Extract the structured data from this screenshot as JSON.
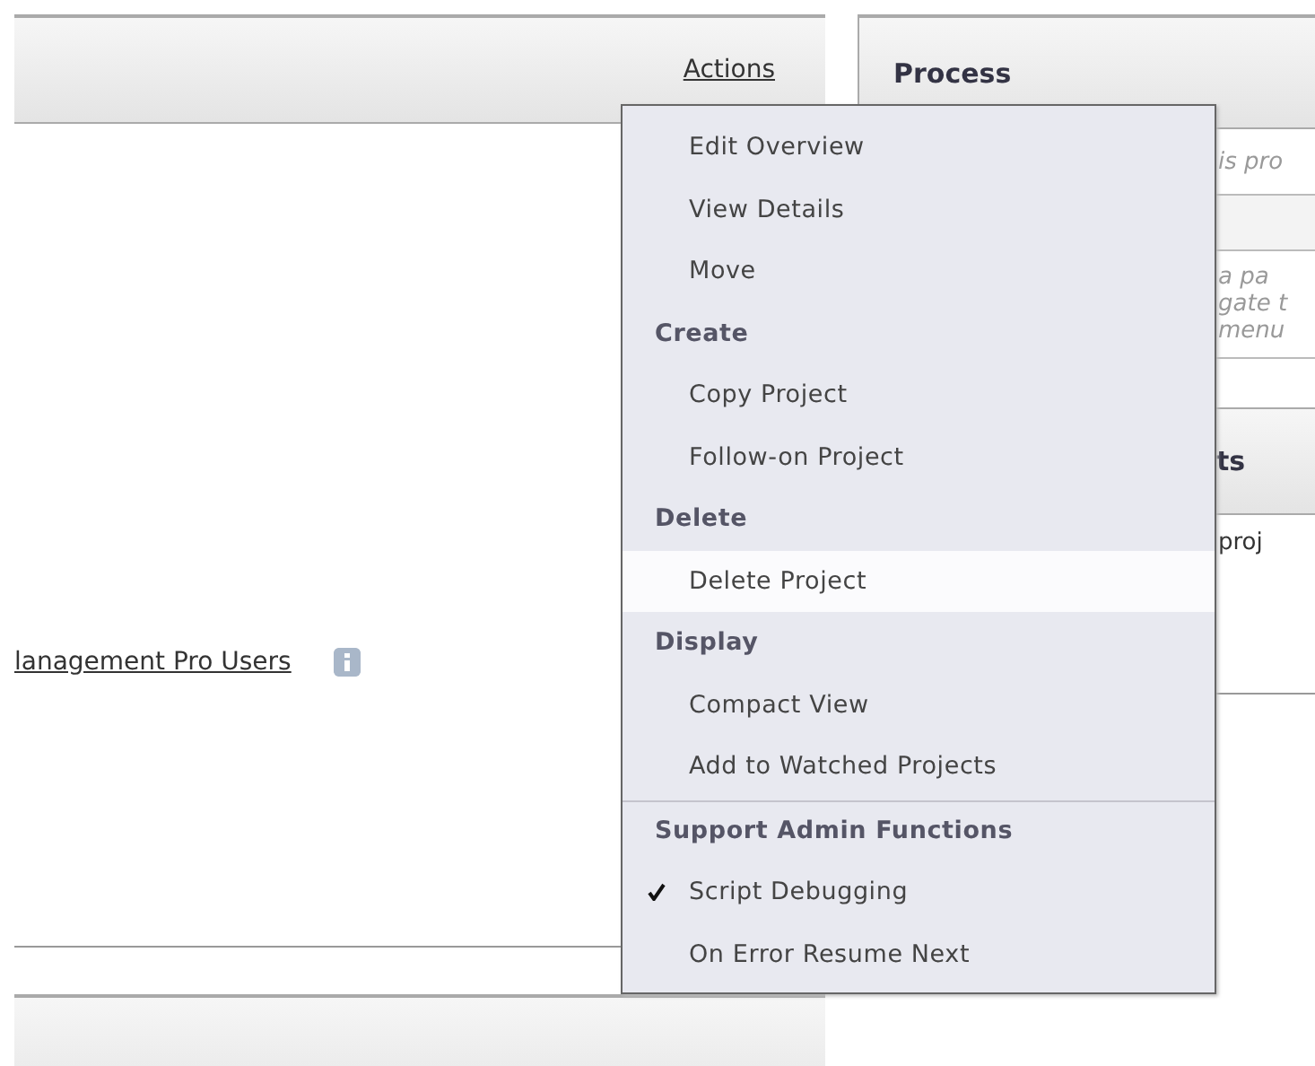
{
  "left_panel": {
    "actions_link": "Actions",
    "group_link": "lanagement Pro Users"
  },
  "right_panel": {
    "title": "Process",
    "hint_1": "is pro",
    "hint_2": [
      "a pa",
      "gate t",
      "menu"
    ],
    "section_title": "ts",
    "section_text": "proj"
  },
  "actions_menu": [
    {
      "kind": "item",
      "label": "Edit Overview",
      "selected": false,
      "checked": false
    },
    {
      "kind": "item",
      "label": "View Details",
      "selected": false,
      "checked": false
    },
    {
      "kind": "item",
      "label": "Move",
      "selected": false,
      "checked": false
    },
    {
      "kind": "header",
      "label": "Create",
      "divider_above": false
    },
    {
      "kind": "item",
      "label": "Copy Project",
      "selected": false,
      "checked": false
    },
    {
      "kind": "item",
      "label": "Follow-on Project",
      "selected": false,
      "checked": false
    },
    {
      "kind": "header",
      "label": "Delete",
      "divider_above": false
    },
    {
      "kind": "item",
      "label": "Delete Project",
      "selected": true,
      "checked": false
    },
    {
      "kind": "header",
      "label": "Display",
      "divider_above": false
    },
    {
      "kind": "item",
      "label": "Compact View",
      "selected": false,
      "checked": false
    },
    {
      "kind": "item",
      "label": "Add to Watched Projects",
      "selected": false,
      "checked": false
    },
    {
      "kind": "header",
      "label": "Support Admin Functions",
      "divider_above": true
    },
    {
      "kind": "item",
      "label": "Script Debugging",
      "selected": false,
      "checked": true
    },
    {
      "kind": "item",
      "label": "On Error Resume Next",
      "selected": false,
      "checked": false
    }
  ]
}
